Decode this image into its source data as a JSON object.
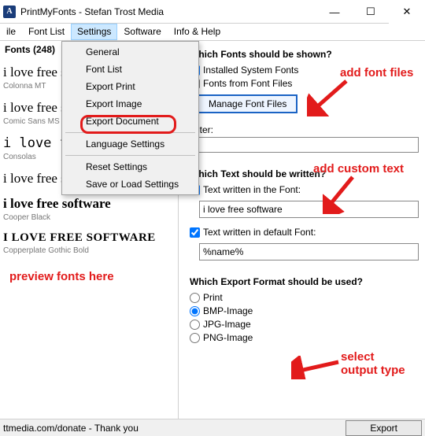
{
  "window": {
    "title": "PrintMyFonts - Stefan Trost Media"
  },
  "menubar": {
    "items": [
      "ile",
      "Font List",
      "Settings",
      "Software",
      "Info & Help"
    ],
    "active_index": 2
  },
  "settings_menu": {
    "items": [
      "General",
      "Font List",
      "Export Print",
      "Export Image",
      "Export Document",
      "Language Settings",
      "Reset Settings",
      "Save or Load Settings"
    ]
  },
  "left": {
    "header": "Fonts (248)",
    "samples": [
      {
        "text": "i love free software",
        "name": "Colonna MT"
      },
      {
        "text": "i love free software",
        "name": "Comic Sans MS"
      },
      {
        "text": "i love free software",
        "name": "Consolas"
      },
      {
        "text": "i love free software",
        "name": ""
      },
      {
        "text": "i love free software",
        "name": "Cooper Black"
      },
      {
        "text": "I LOVE FREE SOFTWARE",
        "name": "Copperplate Gothic Bold"
      }
    ]
  },
  "right": {
    "shown_title": "Which Fonts should be shown?",
    "installed_label": "Installed System Fonts",
    "fromfiles_label": "Fonts from Font Files",
    "manage_label": "Manage Font Files",
    "filter_label": "Filter:",
    "filter_value": "",
    "text_title": "Which Text should be written?",
    "font_text_label": "Text written in the Font:",
    "font_text_value": "i love free software",
    "default_text_label": "Text written in default Font:",
    "default_text_value": "%name%",
    "export_title": "Which Export Format should be used?",
    "formats": [
      "Print",
      "BMP-Image",
      "JPG-Image",
      "PNG-Image"
    ],
    "selected_format_index": 1
  },
  "status": {
    "left": "ttmedia.com/donate - Thank you",
    "export": "Export"
  },
  "annotations": {
    "add_files": "add font files",
    "add_text": "add custom text",
    "preview": "preview fonts here",
    "select_output": "select\noutput type"
  }
}
